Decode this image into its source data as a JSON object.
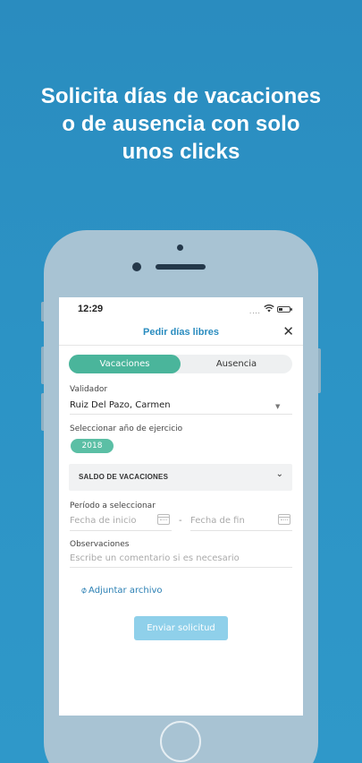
{
  "headline": {
    "line1": "Solicita días de vacaciones",
    "line2": "o de ausencia con solo",
    "line3": "unos clicks"
  },
  "status_bar": {
    "time": "12:29",
    "signal": "····"
  },
  "nav": {
    "title": "Pedir días libres",
    "close": "✕"
  },
  "segment": {
    "active": "Vacaciones",
    "inactive": "Ausencia"
  },
  "validador": {
    "label": "Validador",
    "value": "Ruiz Del Pazo, Carmen"
  },
  "ejercicio": {
    "label": "Seleccionar año de ejercicio",
    "chip": "2018"
  },
  "saldo": {
    "label": "SALDO DE VACACIONES",
    "chevron": "⌄"
  },
  "periodo": {
    "label": "Período a seleccionar",
    "start_placeholder": "Fecha de inicio",
    "separator": "-",
    "end_placeholder": "Fecha de fin"
  },
  "observaciones": {
    "label": "Observaciones",
    "placeholder": "Escribe un comentario si es necesario"
  },
  "attach": {
    "icon": "paperclip-icon",
    "label": "Adjuntar archivo"
  },
  "submit": {
    "label": "Enviar solicitud"
  },
  "colors": {
    "background": "#2b8fc0",
    "accent_green": "#4ab59b",
    "link_blue": "#2a7fb3",
    "button_disabled": "#8fd0ea",
    "phone_body": "#a8c3d3"
  }
}
